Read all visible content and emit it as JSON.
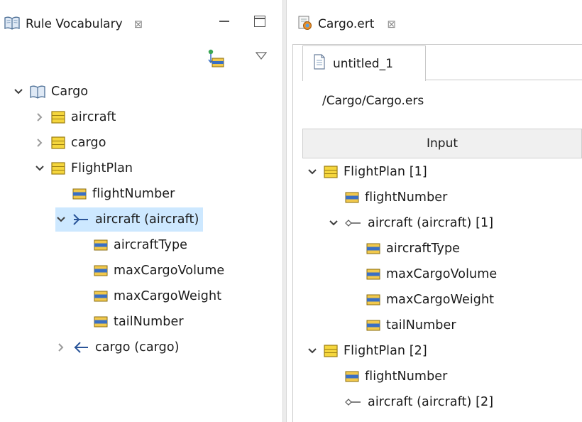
{
  "left_view": {
    "tab_title": "Rule Vocabulary",
    "tab_close": "⊠",
    "tree": [
      {
        "label": "Cargo",
        "icon": "book-icon",
        "twisty": "expanded",
        "indent": 0
      },
      {
        "label": "aircraft",
        "icon": "entity-icon",
        "twisty": "collapsed",
        "indent": 1
      },
      {
        "label": "cargo",
        "icon": "entity-icon",
        "twisty": "collapsed",
        "indent": 1
      },
      {
        "label": "FlightPlan",
        "icon": "entity-icon",
        "twisty": "expanded",
        "indent": 1
      },
      {
        "label": "flightNumber",
        "icon": "attribute-icon",
        "twisty": "none",
        "indent": 2
      },
      {
        "label": "aircraft (aircraft)",
        "icon": "association-many-to-one-icon",
        "twisty": "expanded",
        "indent": 2,
        "selected": true
      },
      {
        "label": "aircraftType",
        "icon": "attribute-icon",
        "twisty": "none",
        "indent": 3
      },
      {
        "label": "maxCargoVolume",
        "icon": "attribute-icon",
        "twisty": "none",
        "indent": 3
      },
      {
        "label": "maxCargoWeight",
        "icon": "attribute-icon",
        "twisty": "none",
        "indent": 3
      },
      {
        "label": "tailNumber",
        "icon": "attribute-icon",
        "twisty": "none",
        "indent": 3
      },
      {
        "label": "cargo (cargo)",
        "icon": "association-one-to-many-icon",
        "twisty": "collapsed",
        "indent": 2
      }
    ]
  },
  "editor": {
    "tab_title": "Cargo.ert",
    "tab_close": "⊠",
    "inner_tab": "untitled_1",
    "path": "/Cargo/Cargo.ers",
    "column_header": "Input",
    "tree": [
      {
        "label": "FlightPlan [1]",
        "icon": "entity-icon",
        "twisty": "expanded",
        "indent": 0
      },
      {
        "label": "flightNumber",
        "icon": "attribute-icon",
        "twisty": "none",
        "indent": 1
      },
      {
        "label": "aircraft (aircraft) [1]",
        "icon": "association-icon",
        "twisty": "expanded",
        "indent": 1
      },
      {
        "label": "aircraftType",
        "icon": "attribute-icon",
        "twisty": "none",
        "indent": 2
      },
      {
        "label": "maxCargoVolume",
        "icon": "attribute-icon",
        "twisty": "none",
        "indent": 2
      },
      {
        "label": "maxCargoWeight",
        "icon": "attribute-icon",
        "twisty": "none",
        "indent": 2
      },
      {
        "label": "tailNumber",
        "icon": "attribute-icon",
        "twisty": "none",
        "indent": 2
      },
      {
        "label": "FlightPlan [2]",
        "icon": "entity-icon",
        "twisty": "expanded",
        "indent": 0
      },
      {
        "label": "flightNumber",
        "icon": "attribute-icon",
        "twisty": "none",
        "indent": 1
      },
      {
        "label": "aircraft (aircraft) [2]",
        "icon": "association-icon",
        "twisty": "none",
        "indent": 1
      }
    ]
  },
  "colors": {
    "selection": "#cde8ff",
    "entity_fill": "#f5d63d",
    "entity_border": "#9a7d12",
    "attribute_fill": "#f2c94c",
    "attribute_band": "#3a6fc4",
    "association": "#2a5599"
  }
}
